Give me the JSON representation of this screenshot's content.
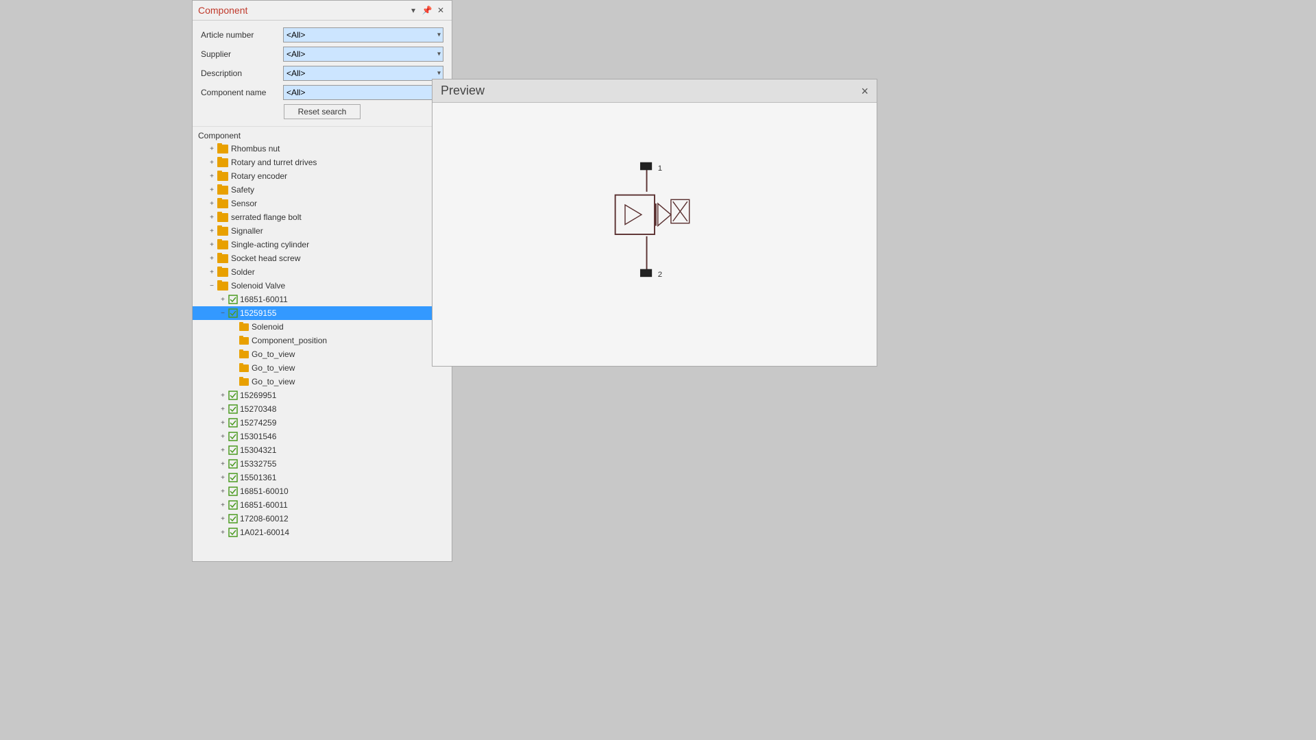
{
  "component_panel": {
    "title": "Component",
    "filters": {
      "article_number": {
        "label": "Article number",
        "value": "<All>",
        "options": [
          "<All>"
        ]
      },
      "supplier": {
        "label": "Supplier",
        "value": "<All>",
        "options": [
          "<All>"
        ]
      },
      "description": {
        "label": "Description",
        "value": "<All>",
        "options": [
          "<All>"
        ]
      },
      "component_name": {
        "label": "Component name",
        "value": "<All>",
        "options": [
          "<All>"
        ]
      }
    },
    "reset_button_label": "Reset search",
    "section_label": "Component",
    "tree_items": [
      {
        "id": "rhombus-nut",
        "label": "Rhombus nut",
        "level": 1,
        "type": "folder",
        "expanded": false
      },
      {
        "id": "rotary-turret",
        "label": "Rotary and turret drives",
        "level": 1,
        "type": "folder",
        "expanded": false
      },
      {
        "id": "rotary-encoder",
        "label": "Rotary encoder",
        "level": 1,
        "type": "folder",
        "expanded": false
      },
      {
        "id": "safety",
        "label": "Safety",
        "level": 1,
        "type": "folder",
        "expanded": false
      },
      {
        "id": "sensor",
        "label": "Sensor",
        "level": 1,
        "type": "folder",
        "expanded": false
      },
      {
        "id": "serrated-flange",
        "label": "serrated flange bolt",
        "level": 1,
        "type": "folder",
        "expanded": false
      },
      {
        "id": "signaller",
        "label": "Signaller",
        "level": 1,
        "type": "folder",
        "expanded": false
      },
      {
        "id": "single-acting",
        "label": "Single-acting cylinder",
        "level": 1,
        "type": "folder",
        "expanded": false
      },
      {
        "id": "socket-head",
        "label": "Socket head screw",
        "level": 1,
        "type": "folder",
        "expanded": false
      },
      {
        "id": "solder",
        "label": "Solder",
        "level": 1,
        "type": "folder",
        "expanded": false
      },
      {
        "id": "solenoid-valve",
        "label": "Solenoid Valve",
        "level": 1,
        "type": "folder",
        "expanded": true
      },
      {
        "id": "sv-16851-60011",
        "label": "16851-60011",
        "level": 2,
        "type": "component",
        "expanded": false
      },
      {
        "id": "sv-15259155",
        "label": "15259155",
        "level": 2,
        "type": "component",
        "expanded": true,
        "selected": true
      },
      {
        "id": "sv-solenoid",
        "label": "Solenoid",
        "level": 3,
        "type": "subfolder"
      },
      {
        "id": "sv-comp-pos",
        "label": "Component_position",
        "level": 3,
        "type": "subfolder"
      },
      {
        "id": "sv-goto1",
        "label": "Go_to_view",
        "level": 3,
        "type": "subfolder"
      },
      {
        "id": "sv-goto2",
        "label": "Go_to_view",
        "level": 3,
        "type": "subfolder"
      },
      {
        "id": "sv-goto3",
        "label": "Go_to_view",
        "level": 3,
        "type": "subfolder"
      },
      {
        "id": "sv-15269951",
        "label": "15269951",
        "level": 2,
        "type": "component",
        "expanded": false
      },
      {
        "id": "sv-15270348",
        "label": "15270348",
        "level": 2,
        "type": "component",
        "expanded": false
      },
      {
        "id": "sv-15274259",
        "label": "15274259",
        "level": 2,
        "type": "component",
        "expanded": false
      },
      {
        "id": "sv-15301546",
        "label": "15301546",
        "level": 2,
        "type": "component",
        "expanded": false
      },
      {
        "id": "sv-15304321",
        "label": "15304321",
        "level": 2,
        "type": "component",
        "expanded": false
      },
      {
        "id": "sv-15332755",
        "label": "15332755",
        "level": 2,
        "type": "component",
        "expanded": false
      },
      {
        "id": "sv-15501361",
        "label": "15501361",
        "level": 2,
        "type": "component",
        "expanded": false
      },
      {
        "id": "sv-16851-60010",
        "label": "16851-60010",
        "level": 2,
        "type": "component",
        "expanded": false
      },
      {
        "id": "sv-16851-60011b",
        "label": "16851-60011",
        "level": 2,
        "type": "component",
        "expanded": false
      },
      {
        "id": "sv-17208-60012",
        "label": "17208-60012",
        "level": 2,
        "type": "component",
        "expanded": false
      },
      {
        "id": "sv-1a021-60014",
        "label": "1A021-60014",
        "level": 2,
        "type": "component",
        "expanded": false
      }
    ]
  },
  "preview_panel": {
    "title": "Preview",
    "close_icon": "×"
  },
  "icons": {
    "pin": "📌",
    "dropdown": "▾",
    "expand": "⊞",
    "collapse": "⊟",
    "expand_sm": "+",
    "collapse_sm": "−"
  }
}
